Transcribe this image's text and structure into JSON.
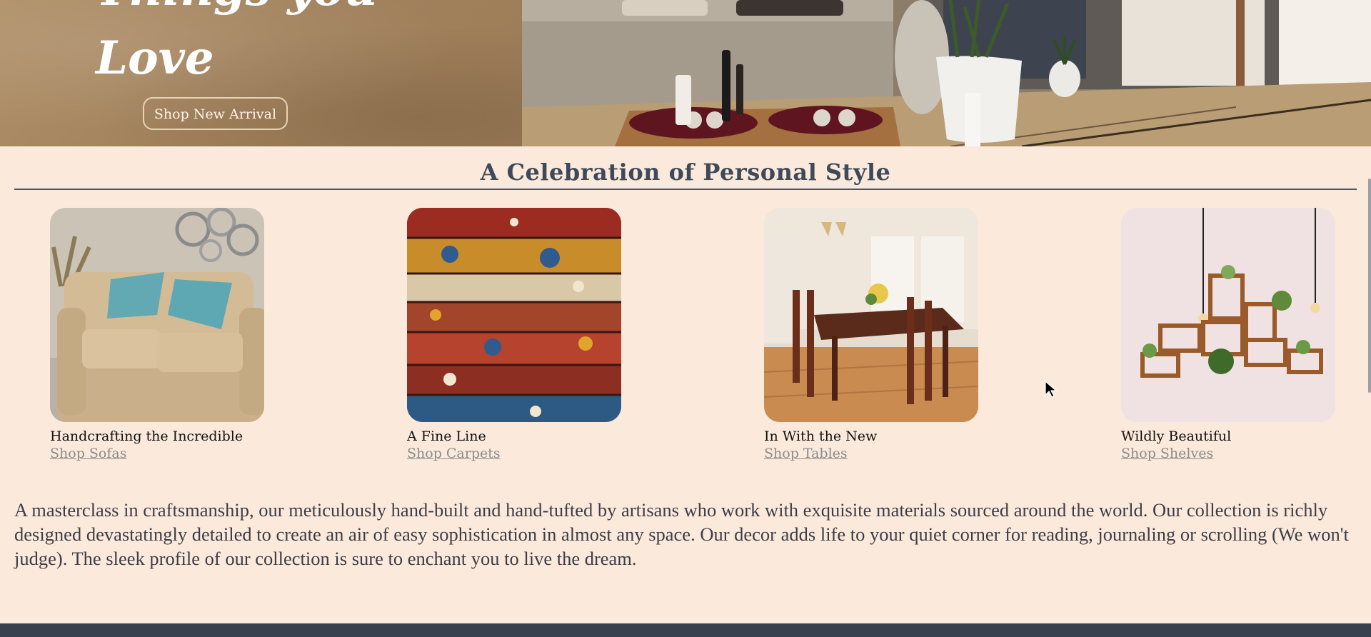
{
  "hero": {
    "title_line1": "Things you",
    "title_line2": "Love",
    "button_label": "Shop New Arrival"
  },
  "section": {
    "title": "A Celebration of Personal Style"
  },
  "cards": [
    {
      "title": "Handcrafting the Incredible",
      "link": "Shop Sofas",
      "image": "beige-loveseat-with-teal-pillows"
    },
    {
      "title": "A Fine Line",
      "link": "Shop Carpets",
      "image": "stack-of-patterned-rugs"
    },
    {
      "title": "In With the New",
      "link": "Shop Tables",
      "image": "wooden-dining-table-with-chairs"
    },
    {
      "title": "Wildly Beautiful",
      "link": "Shop Shelves",
      "image": "wall-cube-shelves-with-plants"
    }
  ],
  "description": "A masterclass in craftsmanship, our meticulously hand-built and hand-tufted by artisans who work with exquisite materials sourced around the world. Our collection is richly designed devastatingly detailed to create an air of easy sophistication in almost any space. Our decor adds life to your quiet corner for reading, journaling or scrolling (We won't judge). The sleek profile of our collection is sure to enchant you to live the dream.",
  "colors": {
    "page_background": "#fbeadc",
    "heading": "#3f4a59",
    "link": "#8b8b8b",
    "footer": "#38414d"
  }
}
